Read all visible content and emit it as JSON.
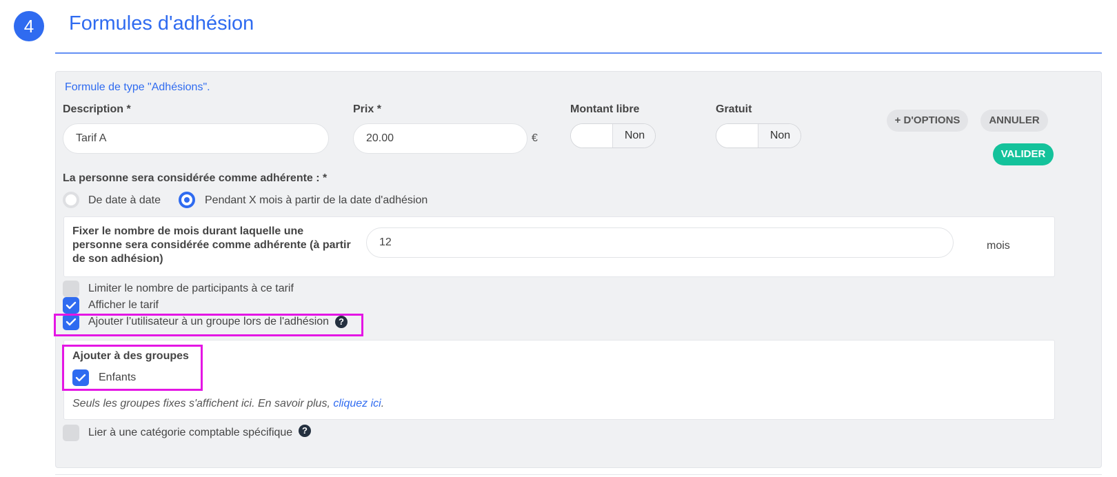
{
  "section": {
    "step_number": "4",
    "title": "Formules d'adhésion"
  },
  "formula": {
    "type_text": "Formule de type \"Adhésions\".",
    "description": {
      "label": "Description *",
      "value": "Tarif A"
    },
    "price": {
      "label": "Prix *",
      "value": "20.00",
      "currency": "€"
    },
    "free_amount": {
      "label": "Montant libre",
      "state": "Non"
    },
    "free": {
      "label": "Gratuit",
      "state": "Non"
    },
    "buttons": {
      "more_options": "+ D'OPTIONS",
      "cancel": "ANNULER",
      "validate": "VALIDER"
    },
    "membership_mode": {
      "label": "La personne sera considérée comme adhérente : *",
      "options": [
        {
          "label": "De date à date",
          "selected": false
        },
        {
          "label": "Pendant X mois à partir de la date d'adhésion",
          "selected": true
        }
      ]
    },
    "months": {
      "label": "Fixer le nombre de mois durant laquelle une personne sera considérée comme adhérente (à partir de son adhésion)",
      "value": "12",
      "unit": "mois"
    },
    "checkboxes": [
      {
        "label": "Limiter le nombre de participants à ce tarif",
        "checked": false
      },
      {
        "label": "Afficher le tarif",
        "checked": true
      },
      {
        "label": "Ajouter l’utilisateur à un groupe lors de l'adhésion",
        "checked": true
      }
    ],
    "groups": {
      "title": "Ajouter à des groupes",
      "items": [
        {
          "label": "Enfants",
          "checked": true
        }
      ],
      "hint_text": "Seuls les groupes fixes s'affichent ici. En savoir plus, ",
      "hint_link": "cliquez ici",
      "hint_end": "."
    },
    "accounting": {
      "label": "Lier à une catégorie comptable spécifique",
      "checked": false
    }
  },
  "icons": {
    "check": "check-icon",
    "help": "question-circle-icon"
  },
  "colors": {
    "primary": "#2f6bf0",
    "validate": "#14c29b",
    "highlight": "#e416e4",
    "help": "#24303f"
  }
}
